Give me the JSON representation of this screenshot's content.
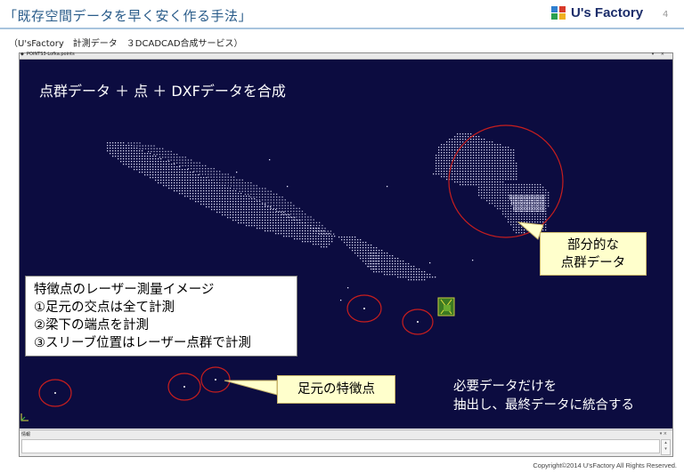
{
  "slide": {
    "title": "「既存空間データを早く安く作る手法」",
    "page_number": "4",
    "subtitle": "（U'sFactory　計測データ　３DCADCAD合成サービス）",
    "logo_text": "U's Factory",
    "copyright": "Copyright©2014  U'sFactory All Rights Reserved."
  },
  "window": {
    "title": "POINTS3-Lofka.points",
    "status_label": "情報"
  },
  "viewer": {
    "caption": "点群データ ＋ 点 ＋ DXFデータを合成",
    "info_box": [
      "特徴点のレーザー測量イメージ",
      "①足元の交点は全て計測",
      "②梁下の端点を計測",
      "③スリーブ位置はレーザー点群で計測"
    ],
    "partial_label": [
      "部分的な",
      "点群データ"
    ],
    "feature_label": "足元の特徴点",
    "extract_text": [
      "必要データだけを",
      "抽出し、最終データに統合する"
    ]
  },
  "colors": {
    "viewport_bg": "#0c0c40",
    "title_text": "#2a5c8a",
    "highlight_circle": "#c81e1e",
    "callout_fill": "#ffffcc",
    "point": "#e8e8ff"
  }
}
